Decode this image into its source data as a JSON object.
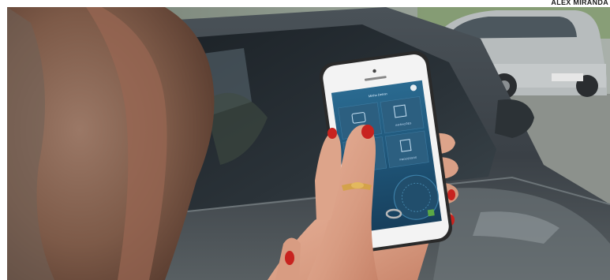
{
  "photo_credit": "ALEX MIRANDA",
  "colors": {
    "car_body": "#3c4348",
    "car_glass": "#242a30",
    "app_background": "#1e4d6e",
    "nail_polish": "#c8231f",
    "phone_case": "#2a2a2a"
  },
  "phone_app": {
    "title": "Minha Detran",
    "tiles": [
      {
        "label": "",
        "icon": "car-icon"
      },
      {
        "label": "INFRAÇÕES",
        "icon": "ticket-icon"
      },
      {
        "label": "",
        "icon": "license-icon"
      },
      {
        "label": "PROCESSOS",
        "icon": "document-icon"
      }
    ]
  }
}
